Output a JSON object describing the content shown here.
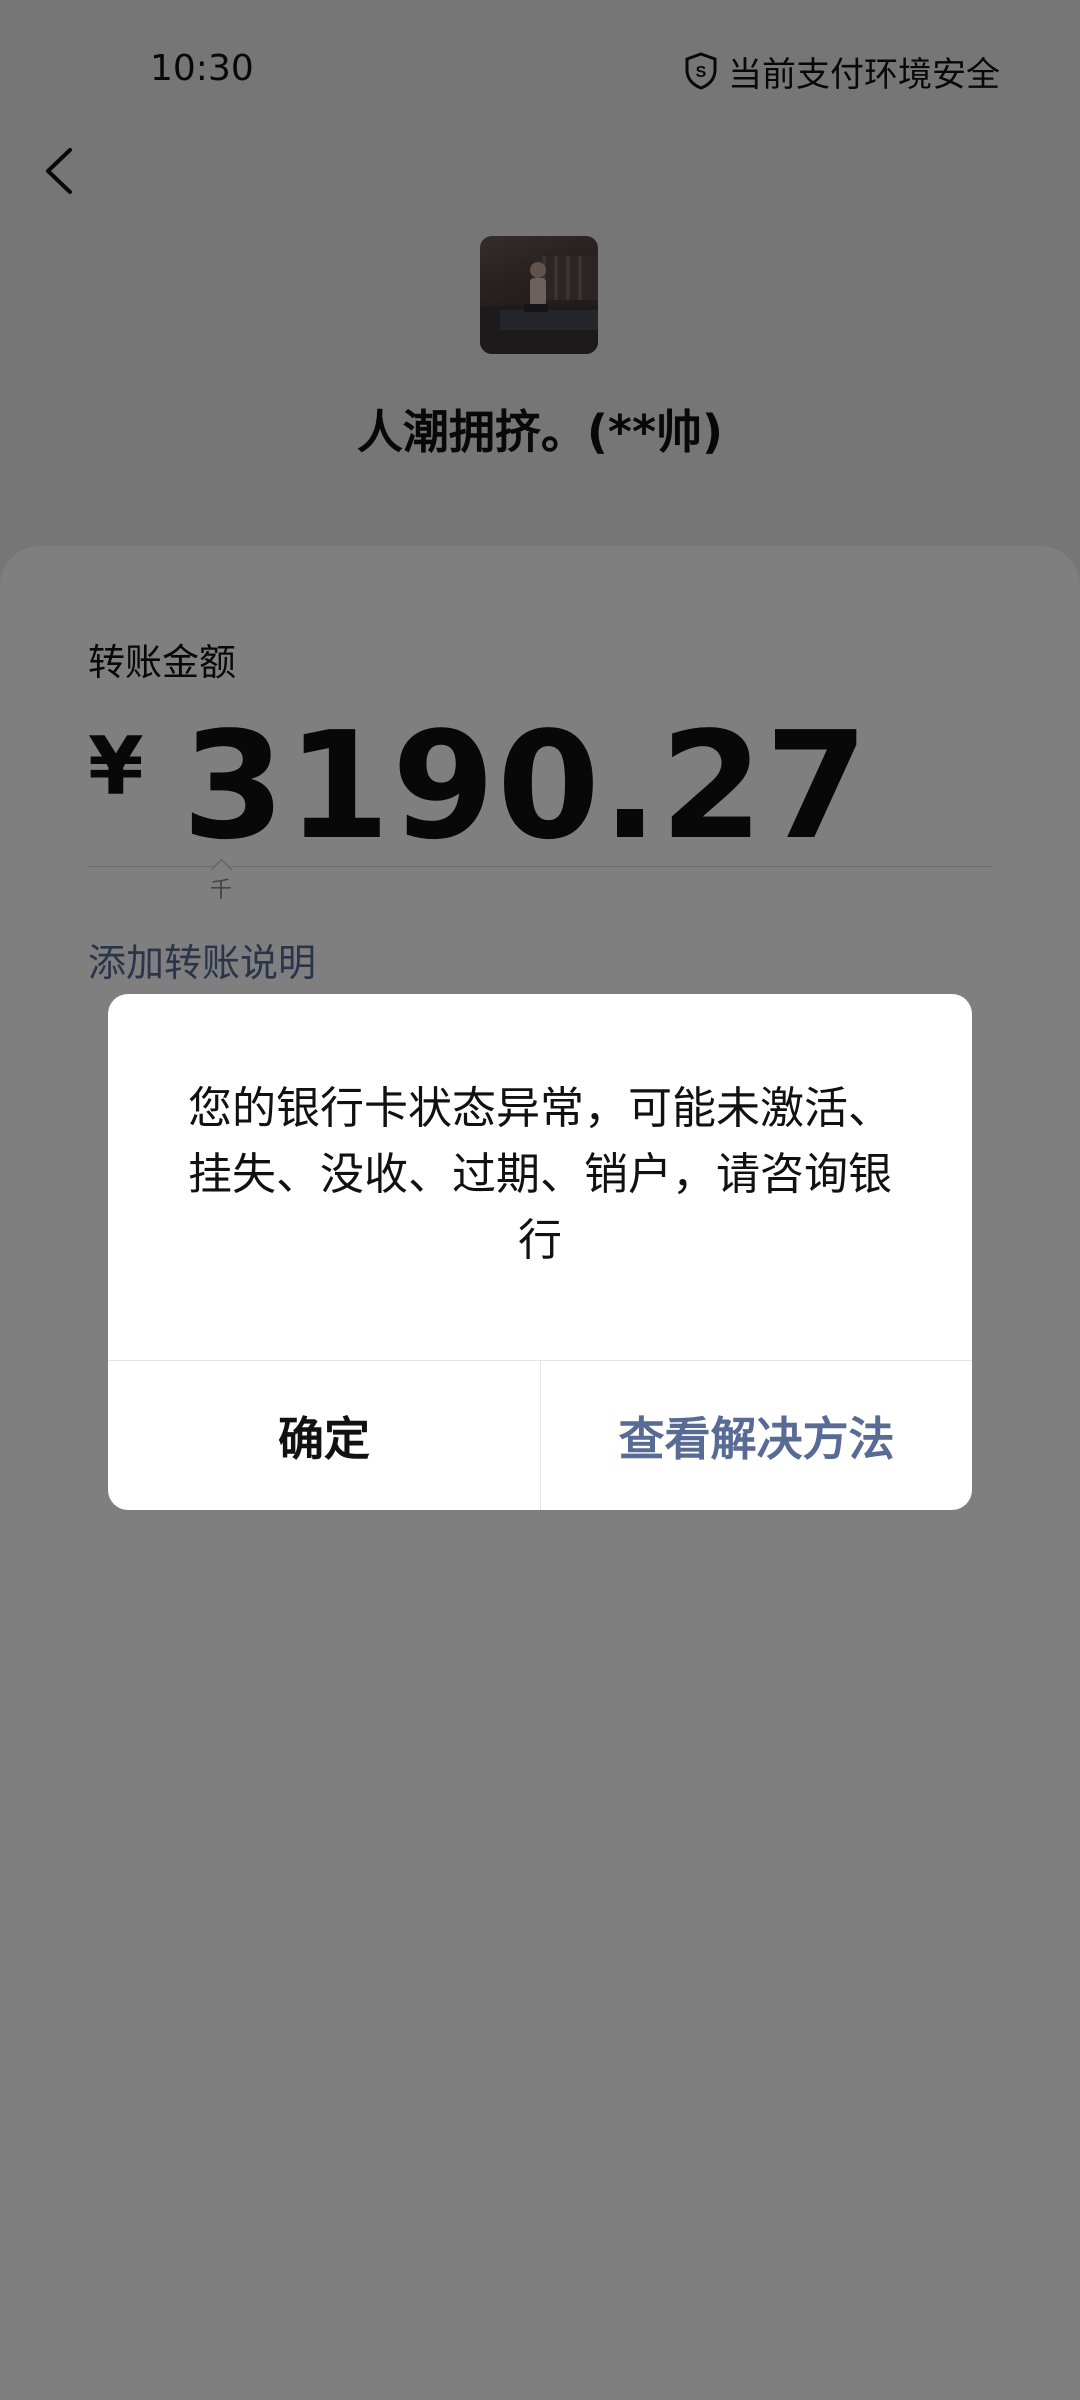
{
  "status_bar": {
    "time": "10:30",
    "security_text": "当前支付环境安全",
    "security_icon": "shield-s-icon"
  },
  "nav": {
    "back_icon": "chevron-left-icon"
  },
  "payee": {
    "name": "人潮拥挤。(**帅)"
  },
  "transfer": {
    "amount_label": "转账金额",
    "currency_symbol": "¥",
    "amount": "3190.27",
    "unit_hint": "千",
    "add_note_link": "添加转账说明"
  },
  "dialog": {
    "message": "您的银行卡状态异常，可能未激活、挂失、没收、过期、销户，请咨询银行",
    "confirm_label": "确定",
    "solution_label": "查看解决方法"
  },
  "colors": {
    "link": "#576b95",
    "overlay": "rgba(0,0,0,0.5)",
    "background": "#ededed",
    "card": "#ffffff"
  }
}
